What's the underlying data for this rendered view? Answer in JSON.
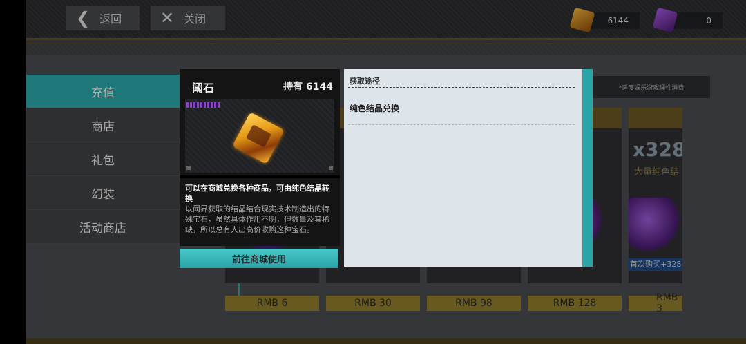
{
  "topbar": {
    "back_label": "返回",
    "close_label": "关闭",
    "currency_gold": "6144",
    "currency_purple": "0"
  },
  "sidebar": {
    "items": [
      {
        "label": "充值",
        "active": true
      },
      {
        "label": "商店",
        "active": false
      },
      {
        "label": "礼包",
        "active": false
      },
      {
        "label": "幻装",
        "active": false
      },
      {
        "label": "活动商店",
        "active": false
      }
    ]
  },
  "notice": "*适度娱乐游戏理性消费",
  "cards": [
    {
      "big": "",
      "sub": "",
      "first_buy": "",
      "price": "RMB 6"
    },
    {
      "big": "",
      "sub": "",
      "first_buy": "",
      "price": "RMB 30"
    },
    {
      "big": "",
      "sub": "",
      "first_buy": "",
      "price": "RMB 98"
    },
    {
      "big": "",
      "sub": "",
      "first_buy": "",
      "price": "RMB 128"
    },
    {
      "big": "x328",
      "sub": "大量纯色结",
      "first_buy": "首次购买+328",
      "price": "RMB 3"
    }
  ],
  "item_popup": {
    "title": "阈石",
    "hold": "持有 6144",
    "desc_head": "可以在商城兑换各种商品，可由纯色结晶转换",
    "desc_body": "以阈界获取的结晶结合现实技术制造出的特殊宝石，虽然具体作用不明，但数量及其稀缺，所以总有人出高价收购这种宝石。",
    "button_label": "前往商城使用"
  },
  "source_panel": {
    "title": "获取途径",
    "items": [
      "纯色结晶兑换"
    ]
  },
  "colors": {
    "accent_teal": "#2aa5a7",
    "gold": "#8f7c2b"
  }
}
